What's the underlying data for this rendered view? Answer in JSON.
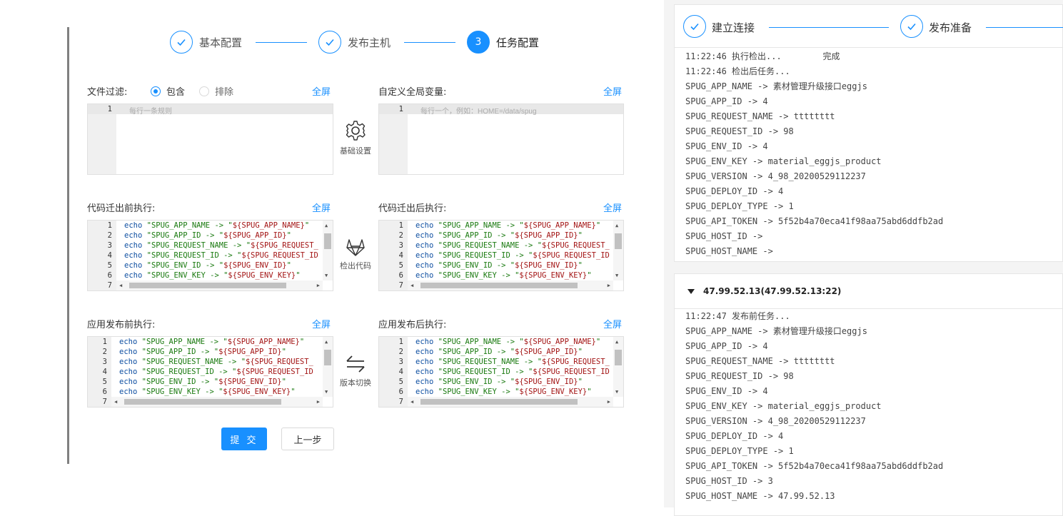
{
  "steps": [
    {
      "label": "基本配置",
      "state": "done"
    },
    {
      "label": "发布主机",
      "state": "done"
    },
    {
      "label": "任务配置",
      "number": "3",
      "state": "active"
    }
  ],
  "file_filter": {
    "label": "文件过滤:",
    "options": [
      "包含",
      "排除"
    ],
    "selected": "包含",
    "fullscreen": "全屏",
    "placeholder": "每行一条规则"
  },
  "global_vars": {
    "label": "自定义全局变量:",
    "fullscreen": "全屏",
    "placeholder": "每行一个，例如：HOME=/data/spug"
  },
  "tools": [
    {
      "icon": "gear-icon",
      "label": "基础设置"
    },
    {
      "icon": "gitlab-icon",
      "label": "检出代码"
    },
    {
      "icon": "swap-icon",
      "label": "版本切换"
    }
  ],
  "editors": [
    {
      "label": "代码迁出前执行:",
      "fullscreen": "全屏"
    },
    {
      "label": "代码迁出后执行:",
      "fullscreen": "全屏"
    },
    {
      "label": "应用发布前执行:",
      "fullscreen": "全屏"
    },
    {
      "label": "应用发布后执行:",
      "fullscreen": "全屏"
    }
  ],
  "code_lines": [
    {
      "kw": "echo",
      "str": "\"SPUG_APP_NAME -> \"",
      "var": "${SPUG_APP_NAME}",
      "tail": "\""
    },
    {
      "kw": "echo",
      "str": "\"SPUG_APP_ID -> \"",
      "var": "${SPUG_APP_ID}",
      "tail": "\""
    },
    {
      "kw": "echo",
      "str": "\"SPUG_REQUEST_NAME -> \"",
      "var": "${SPUG_REQUEST_",
      "tail": ""
    },
    {
      "kw": "echo",
      "str": "\"SPUG_REQUEST_ID -> \"",
      "var": "${SPUG_REQUEST_ID",
      "tail": ""
    },
    {
      "kw": "echo",
      "str": "\"SPUG_ENV_ID -> \"",
      "var": "${SPUG_ENV_ID}",
      "tail": "\""
    },
    {
      "kw": "echo",
      "str": "\"SPUG_ENV_KEY -> \"",
      "var": "${SPUG_ENV_KEY}",
      "tail": "\""
    }
  ],
  "line_numbers": [
    "1",
    "2",
    "3",
    "4",
    "5",
    "6",
    "7"
  ],
  "buttons": {
    "submit": "提 交",
    "prev": "上一步"
  },
  "panel1": {
    "steps": [
      "建立连接",
      "发布准备"
    ],
    "log": [
      "11:22:46 执行检出...        完成",
      "11:22:46 检出后任务...",
      "SPUG_APP_NAME -> 素材管理升级接口eggjs",
      "SPUG_APP_ID -> 4",
      "SPUG_REQUEST_NAME -> tttttttt",
      "SPUG_REQUEST_ID -> 98",
      "SPUG_ENV_ID -> 4",
      "SPUG_ENV_KEY -> material_eggjs_product",
      "SPUG_VERSION -> 4_98_20200529112237",
      "SPUG_DEPLOY_ID -> 4",
      "SPUG_DEPLOY_TYPE -> 1",
      "SPUG_API_TOKEN -> 5f52b4a70eca41f98aa75abd6ddfb2ad",
      "SPUG_HOST_ID ->",
      "SPUG_HOST_NAME ->"
    ]
  },
  "panel2": {
    "host": "47.99.52.13(47.99.52.13:22)",
    "log": [
      "11:22:47 发布前任务...",
      "SPUG_APP_NAME -> 素材管理升级接口eggjs",
      "SPUG_APP_ID -> 4",
      "SPUG_REQUEST_NAME -> tttttttt",
      "SPUG_REQUEST_ID -> 98",
      "SPUG_ENV_ID -> 4",
      "SPUG_ENV_KEY -> material_eggjs_product",
      "SPUG_VERSION -> 4_98_20200529112237",
      "SPUG_DEPLOY_ID -> 4",
      "SPUG_DEPLOY_TYPE -> 1",
      "SPUG_API_TOKEN -> 5f52b4a70eca41f98aa75abd6ddfb2ad",
      "SPUG_HOST_ID -> 3",
      "SPUG_HOST_NAME -> 47.99.52.13"
    ]
  },
  "colors": {
    "primary": "#1890ff",
    "bar": "#808080"
  }
}
